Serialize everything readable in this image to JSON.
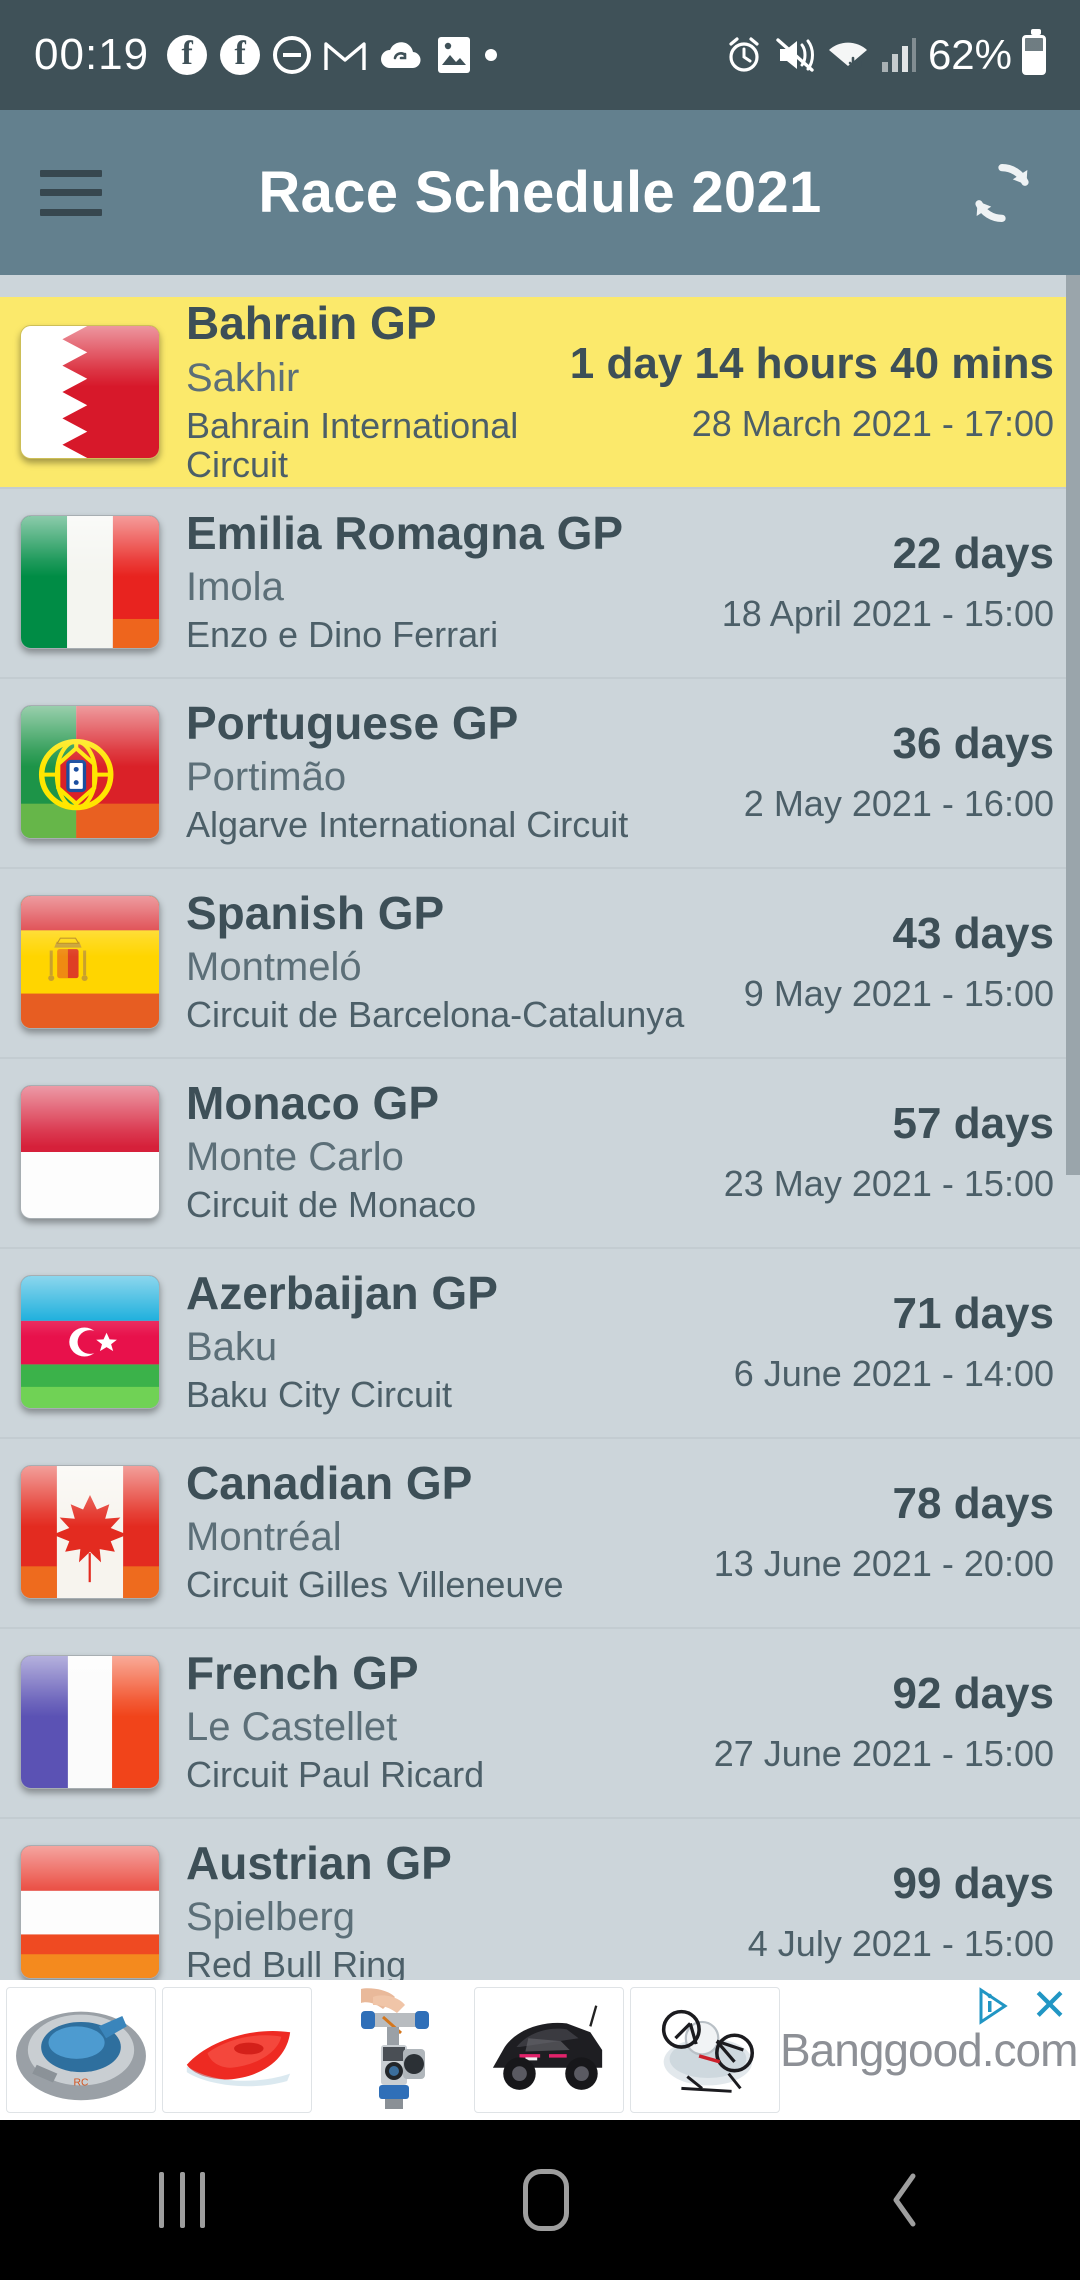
{
  "statusbar": {
    "time": "00:19",
    "battery_percent": "62%",
    "icons": [
      "facebook-icon",
      "facebook-icon",
      "do-not-disturb-icon",
      "gmail-icon",
      "cloud-sync-icon",
      "photo-icon",
      "dot-icon",
      "alarm-icon",
      "vibrate-mute-icon",
      "wifi-icon",
      "signal-icon"
    ]
  },
  "appbar": {
    "menu_icon": "hamburger-menu-icon",
    "title": "Race Schedule 2021",
    "refresh_icon": "refresh-sync-icon"
  },
  "races": [
    {
      "flag": "bahrain-flag",
      "name": "Bahrain GP",
      "city": "Sakhir",
      "circuit": "Bahrain International Circuit",
      "countdown": "1 day 14 hours 40 mins",
      "datetime": "28 March 2021 - 17:00",
      "highlighted": true
    },
    {
      "flag": "italy-flag",
      "name": "Emilia Romagna GP",
      "city": "Imola",
      "circuit": "Enzo e Dino Ferrari",
      "countdown": "22 days",
      "datetime": "18 April 2021 - 15:00",
      "highlighted": false
    },
    {
      "flag": "portugal-flag",
      "name": "Portuguese GP",
      "city": "Portimão",
      "circuit": "Algarve International Circuit",
      "countdown": "36 days",
      "datetime": "2 May 2021 - 16:00",
      "highlighted": false
    },
    {
      "flag": "spain-flag",
      "name": "Spanish GP",
      "city": "Montmeló",
      "circuit": "Circuit de Barcelona-Catalunya",
      "countdown": "43 days",
      "datetime": "9 May 2021 - 15:00",
      "highlighted": false
    },
    {
      "flag": "monaco-flag",
      "name": "Monaco GP",
      "city": "Monte Carlo",
      "circuit": "Circuit de Monaco",
      "countdown": "57 days",
      "datetime": "23 May 2021 - 15:00",
      "highlighted": false
    },
    {
      "flag": "azerbaijan-flag",
      "name": "Azerbaijan GP",
      "city": "Baku",
      "circuit": "Baku City Circuit",
      "countdown": "71 days",
      "datetime": "6 June 2021 - 14:00",
      "highlighted": false
    },
    {
      "flag": "canada-flag",
      "name": "Canadian GP",
      "city": "Montréal",
      "circuit": "Circuit Gilles Villeneuve",
      "countdown": "78 days",
      "datetime": "13 June 2021 - 20:00",
      "highlighted": false
    },
    {
      "flag": "france-flag",
      "name": "French GP",
      "city": "Le Castellet",
      "circuit": "Circuit Paul Ricard",
      "countdown": "92 days",
      "datetime": "27 June 2021 - 15:00",
      "highlighted": false
    },
    {
      "flag": "austria-flag",
      "name": "Austrian GP",
      "city": "Spielberg",
      "circuit": "Red Bull Ring",
      "countdown": "99 days",
      "datetime": "4 July 2021 - 15:00",
      "highlighted": false
    }
  ],
  "ad": {
    "brand": "Banggood.com",
    "close_label": "✕",
    "adchoices_icon": "adchoices-icon",
    "products": [
      "rc-hovercraft",
      "rc-boat",
      "camera-gimbal",
      "rc-car",
      "rc-drone"
    ]
  },
  "navbar": {
    "recents_icon": "recents-icon",
    "home_icon": "home-icon",
    "back_icon": "back-icon"
  },
  "colors": {
    "statusbar_bg": "#3f5158",
    "appbar_bg": "#63808e",
    "list_bg": "#ccd5da",
    "highlight_bg": "#fbe96b",
    "primary_text": "#3d4f57",
    "secondary_text": "#5c6f78",
    "scrollbar": "#9aa5ab",
    "ad_accent": "#2196c4"
  }
}
